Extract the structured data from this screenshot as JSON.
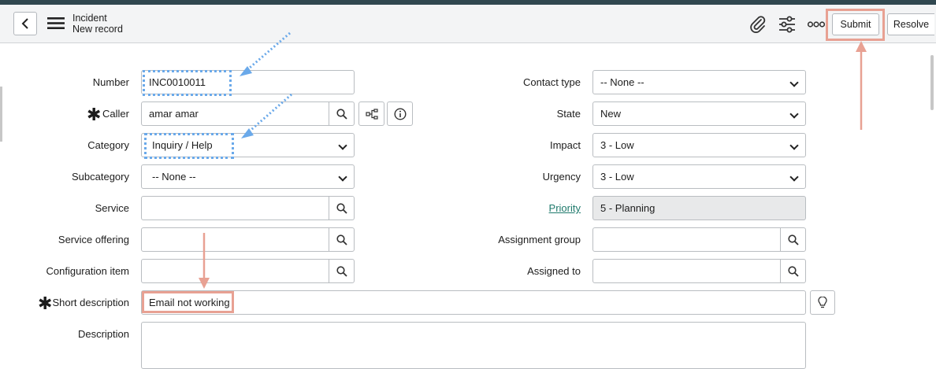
{
  "header": {
    "title": "Incident",
    "subtitle": "New record",
    "submit_label": "Submit",
    "resolve_label": "Resolve"
  },
  "left": {
    "number": {
      "label": "Number",
      "value": "INC0010011"
    },
    "caller": {
      "label": "Caller",
      "value": "amar amar"
    },
    "category": {
      "label": "Category",
      "value": "Inquiry / Help"
    },
    "subcategory": {
      "label": "Subcategory",
      "value": "-- None --"
    },
    "service": {
      "label": "Service",
      "value": ""
    },
    "service_offering": {
      "label": "Service offering",
      "value": ""
    },
    "configuration_item": {
      "label": "Configuration item",
      "value": ""
    },
    "short_description": {
      "label": "Short description",
      "value": "Email not working"
    },
    "description": {
      "label": "Description",
      "value": ""
    }
  },
  "right": {
    "contact_type": {
      "label": "Contact type",
      "value": "-- None --"
    },
    "state": {
      "label": "State",
      "value": "New"
    },
    "impact": {
      "label": "Impact",
      "value": "3 - Low"
    },
    "urgency": {
      "label": "Urgency",
      "value": "3 - Low"
    },
    "priority": {
      "label": "Priority",
      "value": "5 - Planning"
    },
    "assignment_group": {
      "label": "Assignment group",
      "value": ""
    },
    "assigned_to": {
      "label": "Assigned to",
      "value": ""
    }
  },
  "colors": {
    "annotation_red": "#e8a193",
    "annotation_blue": "#6aa9ea",
    "link": "#1f7a6c"
  },
  "icons": [
    "back-icon",
    "menu-icon",
    "paperclip-icon",
    "settings-sliders-icon",
    "more-icon",
    "search-icon",
    "hierarchy-icon",
    "info-icon",
    "lightbulb-icon"
  ]
}
